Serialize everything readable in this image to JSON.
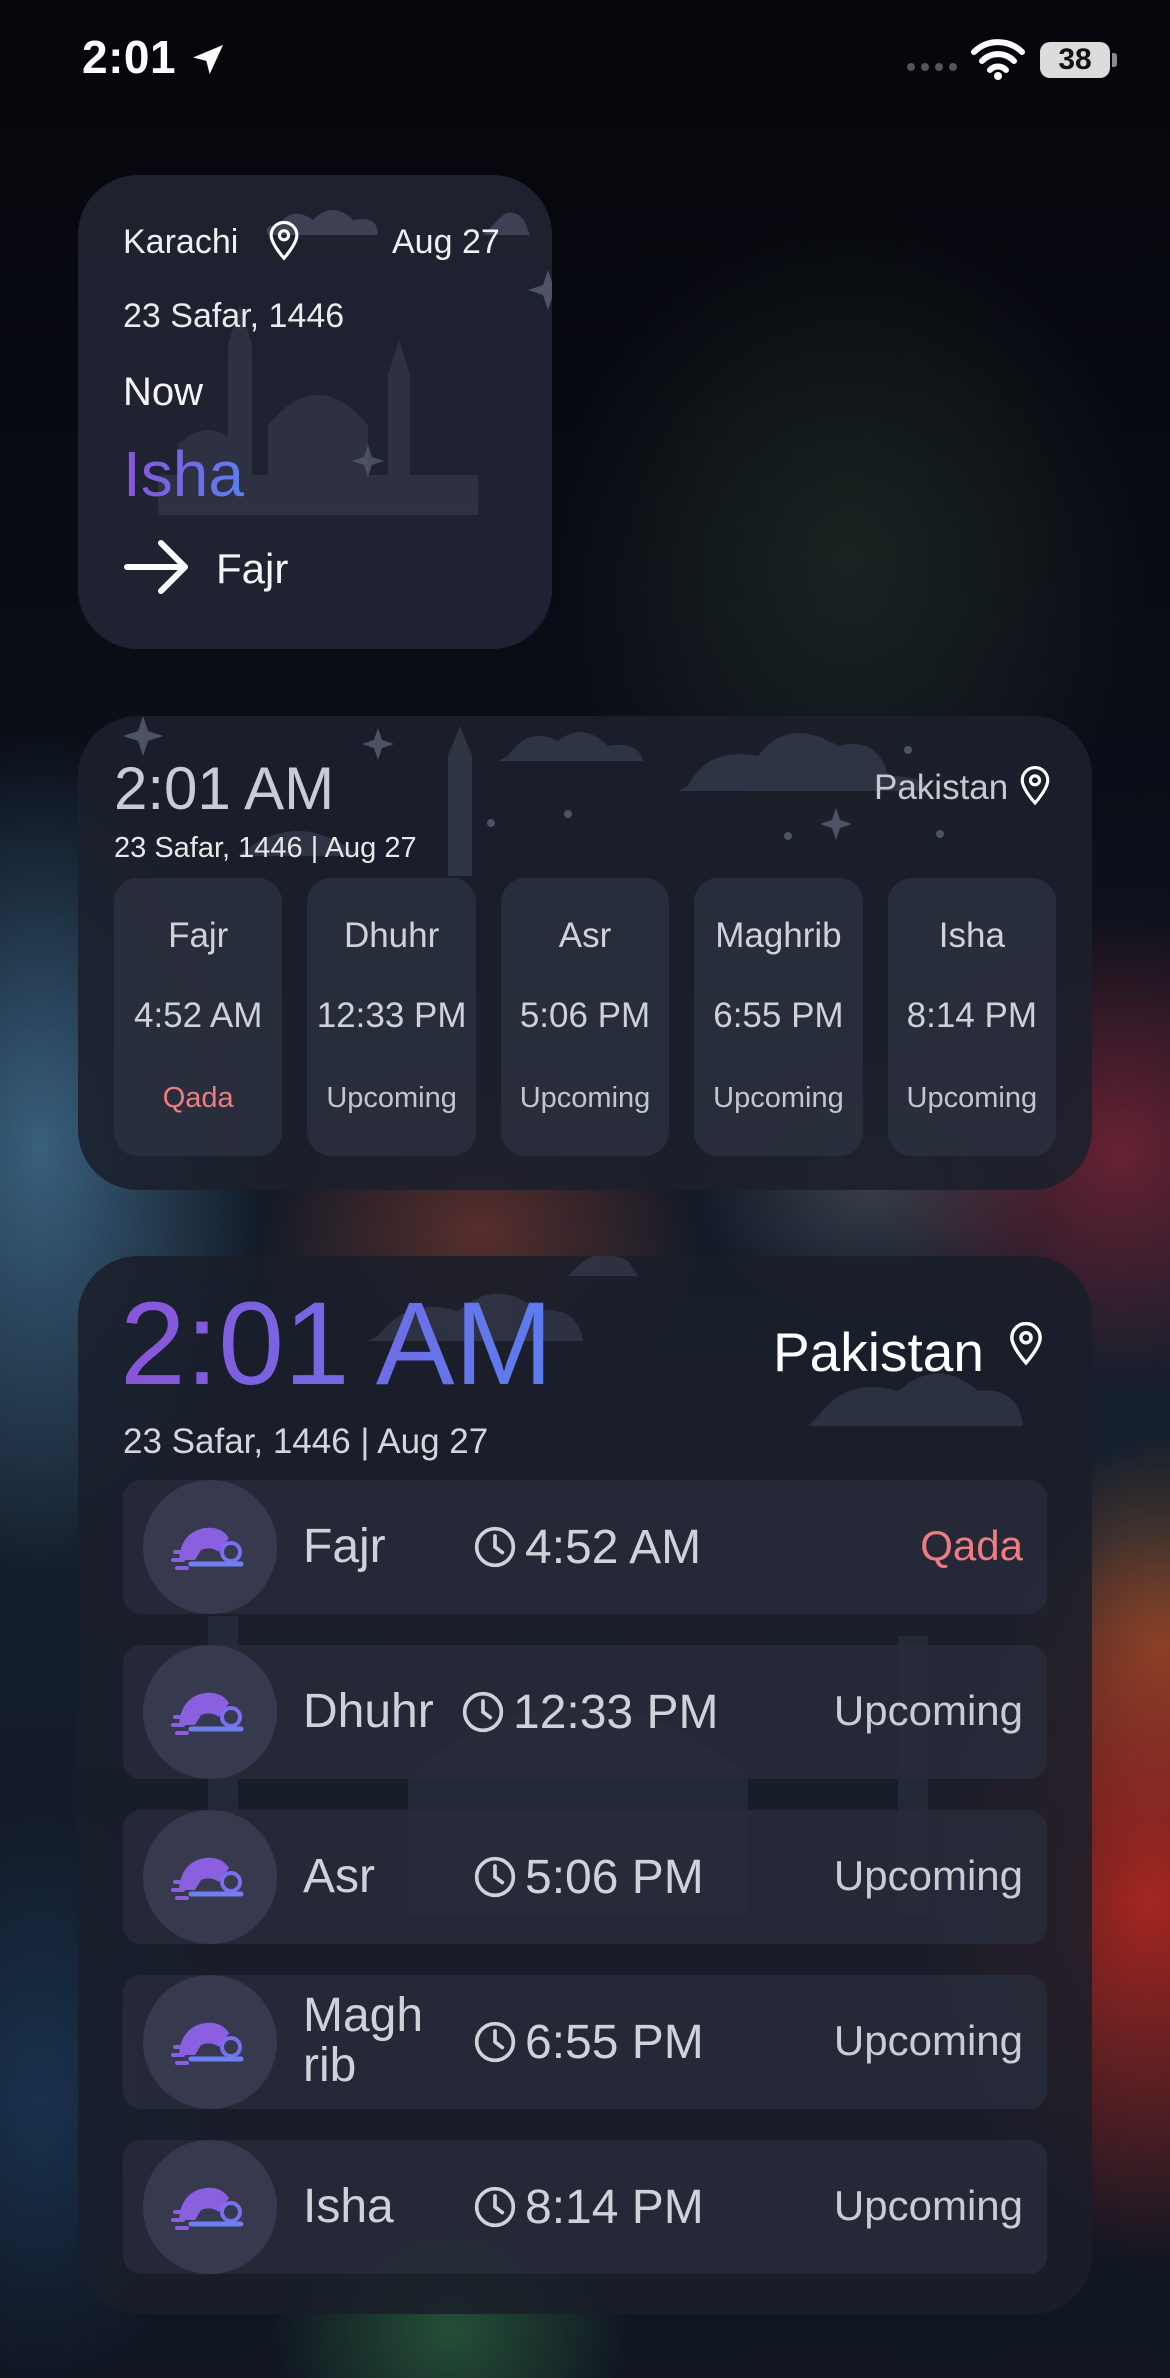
{
  "status_bar": {
    "time": "2:01",
    "battery": "38",
    "icons": [
      "location-arrow-icon",
      "signal-dots-icon",
      "wifi-icon",
      "battery-icon"
    ]
  },
  "small_widget": {
    "city": "Karachi",
    "gregorian_date": "Aug 27",
    "hijri_date": "23 Safar, 1446",
    "now_label": "Now",
    "current_prayer": "Isha",
    "next_prayer": "Fajr",
    "icons": [
      "location-pin-icon",
      "arrow-right-icon"
    ]
  },
  "medium_widget": {
    "time": "2:01 AM",
    "date_line": "23 Safar, 1446 | Aug 27",
    "country": "Pakistan",
    "prayers": [
      {
        "name": "Fajr",
        "time": "4:52 AM",
        "status": "Qada"
      },
      {
        "name": "Dhuhr",
        "time": "12:33 PM",
        "status": "Upcoming"
      },
      {
        "name": "Asr",
        "time": "5:06 PM",
        "status": "Upcoming"
      },
      {
        "name": "Maghrib",
        "time": "6:55 PM",
        "status": "Upcoming"
      },
      {
        "name": "Isha",
        "time": "8:14 PM",
        "status": "Upcoming"
      }
    ]
  },
  "large_widget": {
    "time": "2:01 AM",
    "date_line": "23 Safar, 1446 | Aug 27",
    "country": "Pakistan",
    "prayers": [
      {
        "name": "Fajr",
        "time": "4:52 AM",
        "status": "Qada"
      },
      {
        "name": "Dhuhr",
        "time": "12:33 PM",
        "status": "Upcoming"
      },
      {
        "name": "Asr",
        "time": "5:06 PM",
        "status": "Upcoming"
      },
      {
        "name": "Magh\nrib",
        "time": "6:55 PM",
        "status": "Upcoming"
      },
      {
        "name": "Isha",
        "time": "8:14 PM",
        "status": "Upcoming"
      }
    ],
    "icons": [
      "prayer-icon",
      "clock-icon",
      "location-pin-icon"
    ]
  },
  "colors": {
    "accent_gradient_start": "#8a55d8",
    "accent_gradient_end": "#5b7ef0",
    "qada": "#f07b80"
  }
}
